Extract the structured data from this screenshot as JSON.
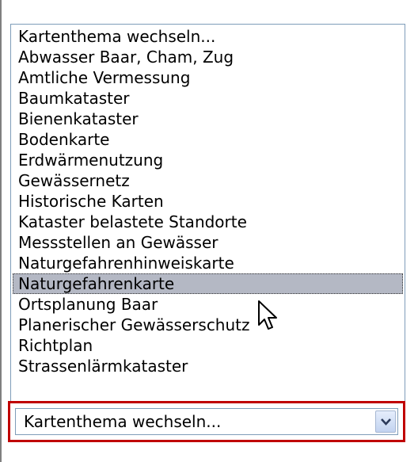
{
  "listbox": {
    "items": [
      "Kartenthema wechseln...",
      "Abwasser Baar, Cham, Zug",
      "Amtliche Vermessung",
      "Baumkataster",
      "Bienenkataster",
      "Bodenkarte",
      "Erdwärmenutzung",
      "Gewässernetz",
      "Historische Karten",
      "Kataster belastete Standorte",
      "Messstellen an Gewässer",
      "Naturgefahrenhinweiskarte",
      "Naturgefahrenkarte",
      "Ortsplanung Baar",
      "Planerischer Gewässerschutz",
      "Richtplan",
      "Strassenlärmkataster"
    ],
    "selected_index": 12
  },
  "dropdown": {
    "value": "Kartenthema wechseln...",
    "arrow_icon": "chevron-down-icon"
  },
  "colors": {
    "highlight": "#b4b8c4",
    "focus_border": "#c00000",
    "list_border": "#7f9db9"
  }
}
